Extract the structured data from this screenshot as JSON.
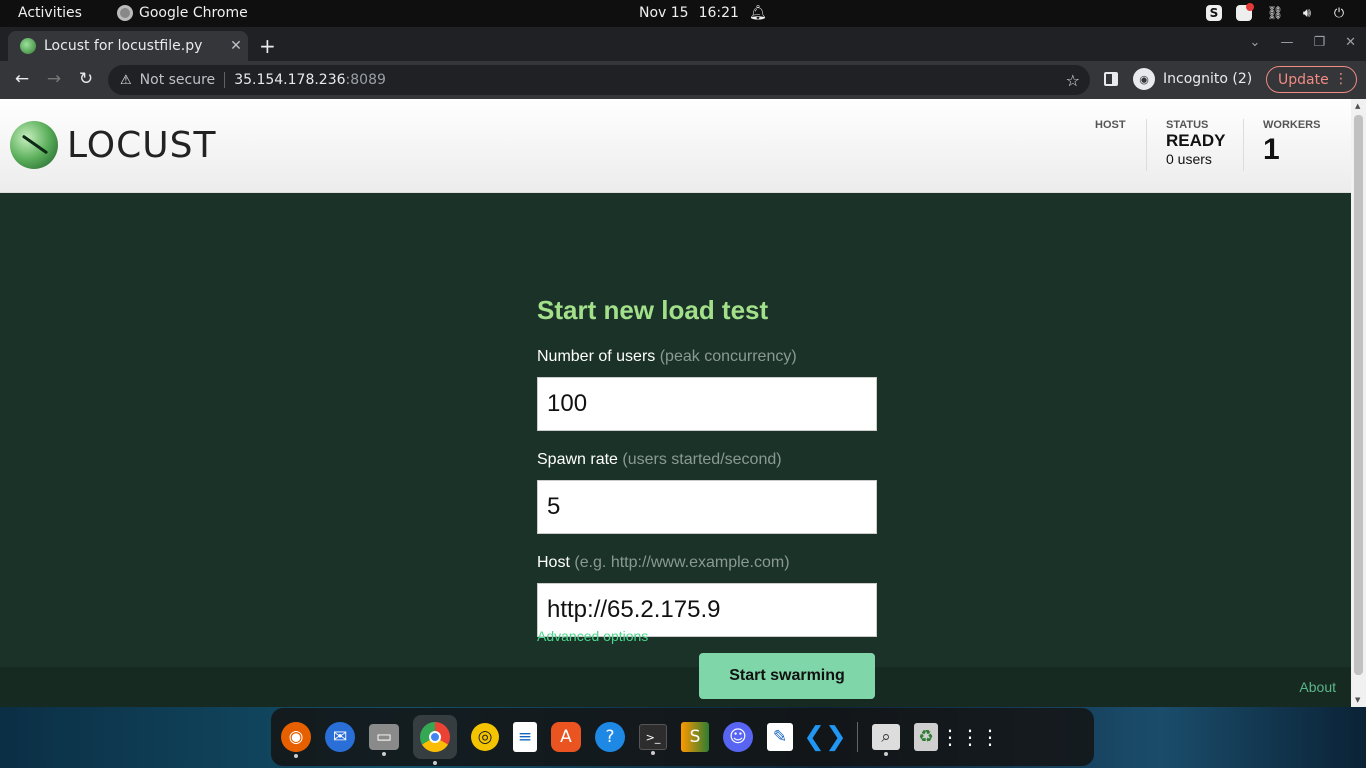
{
  "system_bar": {
    "activities": "Activities",
    "app_name": "Google Chrome",
    "date": "Nov 15",
    "time": "16:21"
  },
  "browser": {
    "tab_title": "Locust for locustfile.py",
    "tab_close": "✕",
    "new_tab": "+",
    "security_label": "Not secure",
    "url_host": "35.154.178.236",
    "url_port": ":8089",
    "incognito_label": "Incognito (2)",
    "update_label": "Update"
  },
  "header": {
    "logo_text": "LOCUST",
    "host_label": "HOST",
    "status_label": "STATUS",
    "status_value": "READY",
    "status_users": "0 users",
    "workers_label": "WORKERS",
    "workers_value": "1"
  },
  "form": {
    "title": "Start new load test",
    "users_label": "Number of users",
    "users_hint": "(peak concurrency)",
    "users_value": "100",
    "spawn_label": "Spawn rate",
    "spawn_hint": "(users started/second)",
    "spawn_value": "5",
    "host_label": "Host",
    "host_hint": "(e.g. http://www.example.com)",
    "host_value": "http://65.2.175.9",
    "advanced_link": "Advanced options",
    "submit_label": "Start swarming"
  },
  "footer": {
    "about_link": "About"
  },
  "dock": {
    "apps": [
      "firefox-icon",
      "thunderbird-icon",
      "files-icon",
      "chrome-icon",
      "rhythmbox-icon",
      "writer-icon",
      "software-icon",
      "help-icon",
      "terminal-icon",
      "sublime-icon",
      "discord-icon",
      "text-editor-icon",
      "vscode-icon",
      "image-viewer-icon",
      "trash-icon",
      "app-grid-icon"
    ]
  },
  "colors": {
    "page_bg": "#1b3228",
    "title_green": "#a3e08a",
    "button_green": "#7fd6a8",
    "link_green": "#4cd68d"
  }
}
